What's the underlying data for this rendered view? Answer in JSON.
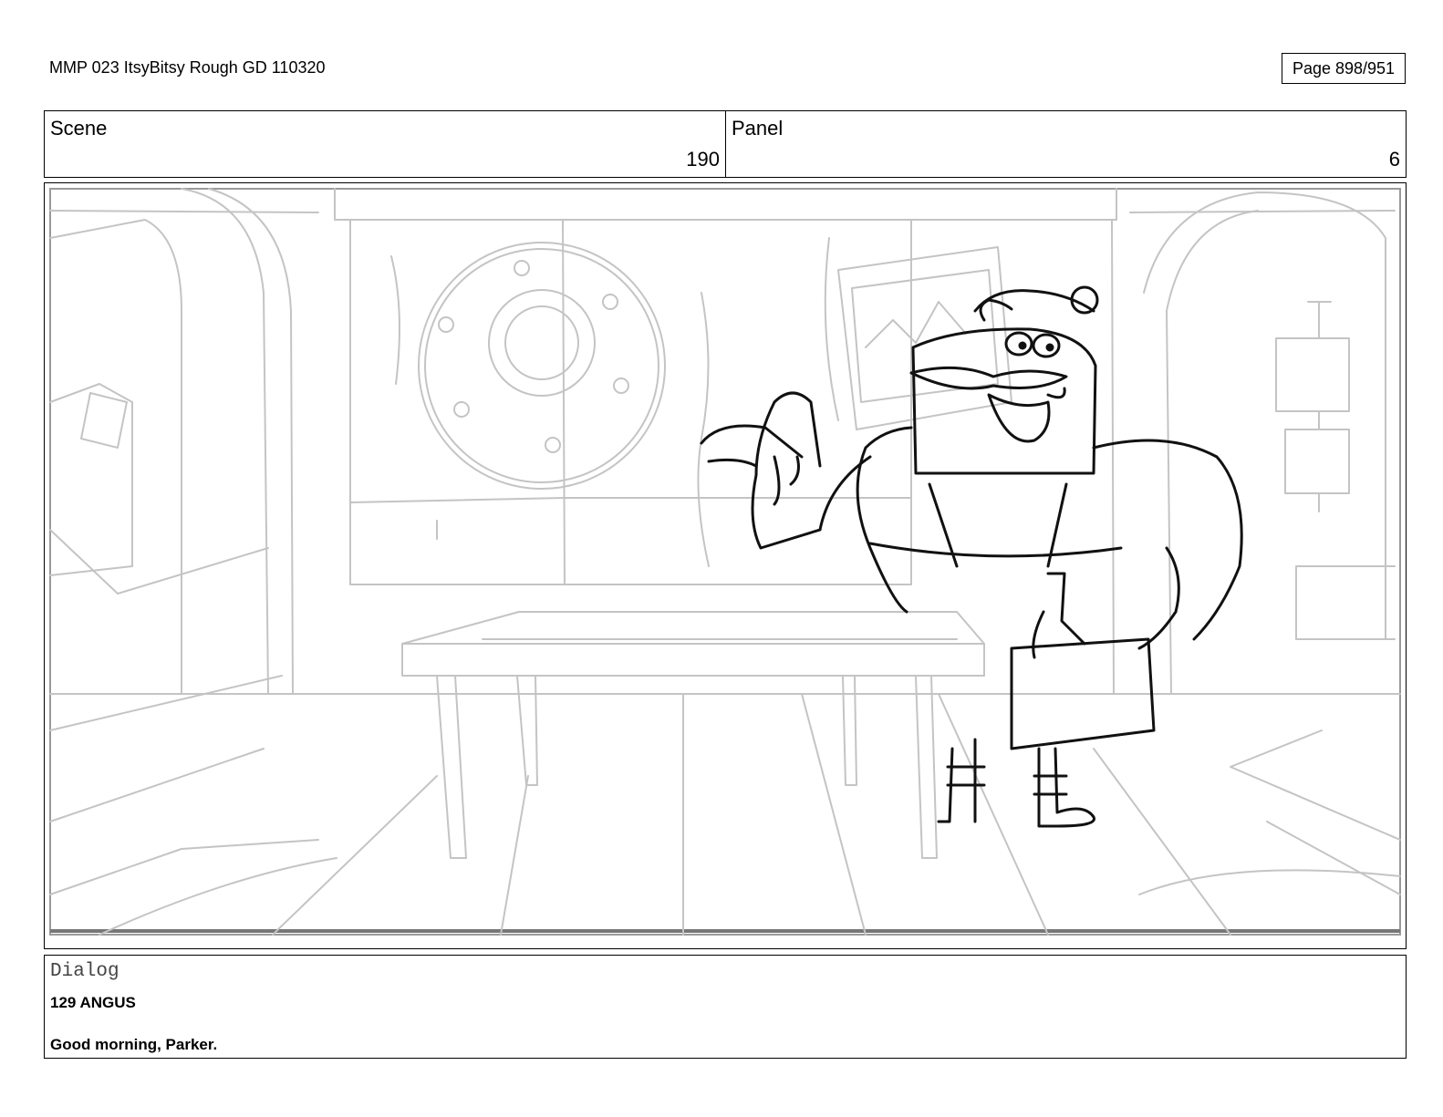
{
  "document": {
    "title": "MMP 023 ItsyBitsy Rough GD 110320",
    "page": "Page 898/951"
  },
  "header": {
    "scene_label": "Scene",
    "scene_value": "190",
    "panel_label": "Panel",
    "panel_value": "6"
  },
  "panel_image": {
    "description_icon": "storyboard-sketch"
  },
  "dialog": {
    "label": "Dialog",
    "speaker": "129 ANGUS",
    "line": "Good morning, Parker."
  }
}
